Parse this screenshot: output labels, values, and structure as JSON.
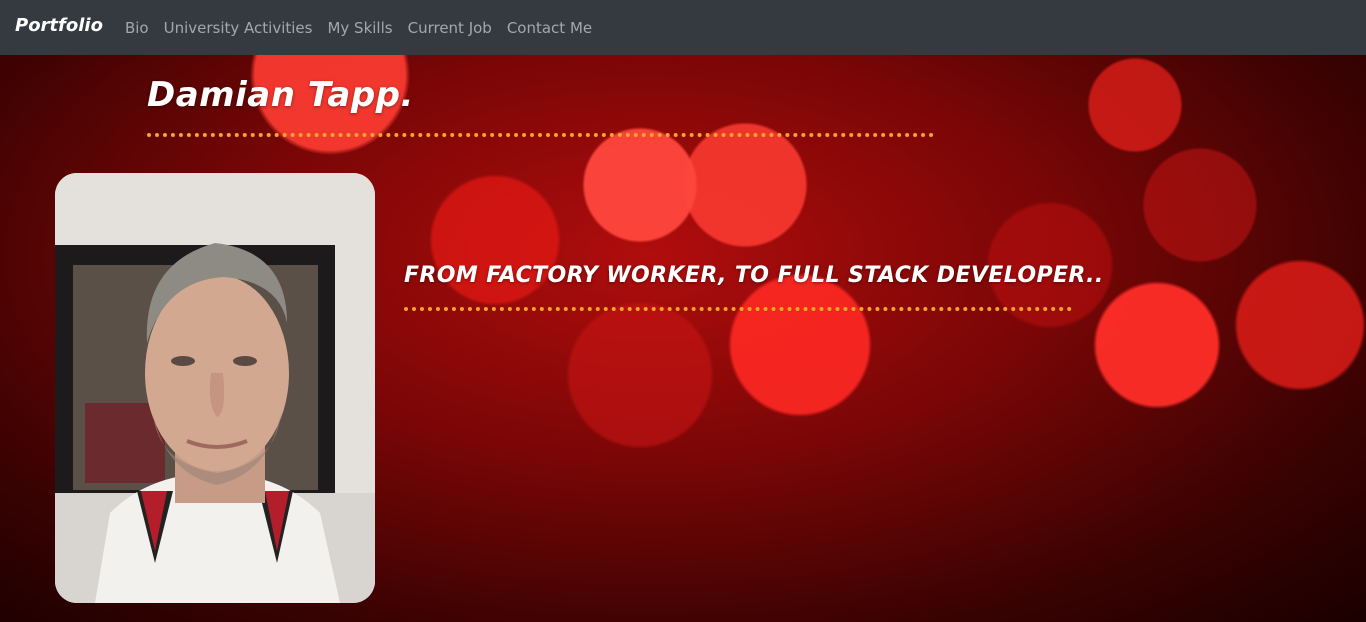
{
  "navbar": {
    "brand": "Portfolio",
    "links": [
      "Bio",
      "University Activities",
      "My Skills",
      "Current Job",
      "Contact Me"
    ]
  },
  "hero": {
    "name": "Damian Tapp.",
    "tagline": "FROM FACTORY WORKER, TO FULL STACK DEVELOPER.."
  },
  "colors": {
    "navbar_bg": "#343a40",
    "accent_dots": "#f5a623",
    "hero_red": "#b00d0d"
  }
}
